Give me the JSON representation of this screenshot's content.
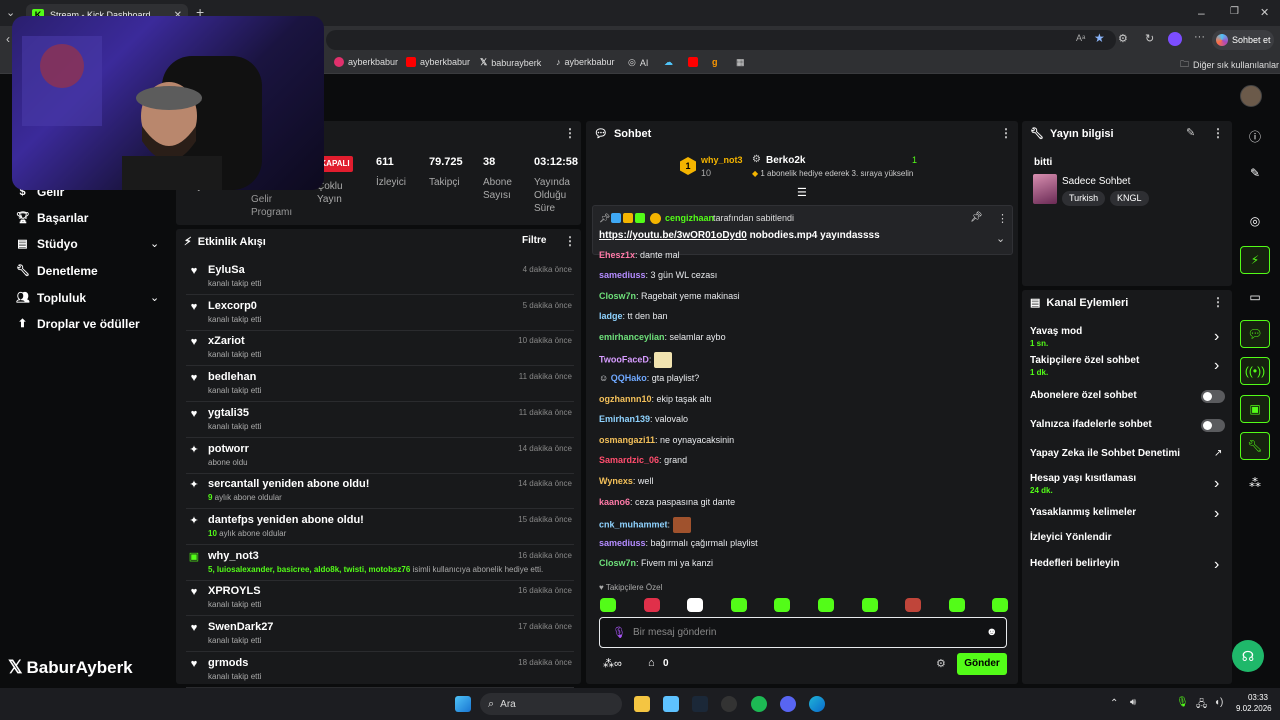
{
  "browser": {
    "tab_title": "Stream - Kick Dashboard",
    "copilot_label": "Sohbet et",
    "bookmarks": [
      {
        "label": "ayberkbabur",
        "color": "#e1306c"
      },
      {
        "label": "ayberkbabur",
        "color": "#ff0000"
      },
      {
        "label": "baburayberk",
        "color": "#ffffff"
      },
      {
        "label": "ayberkbabur",
        "color": "#ffffff"
      },
      {
        "label": "AI",
        "color": "#cccccc"
      }
    ],
    "other_bookmarks": "Diğer sık kullanılanlar"
  },
  "sidebar": {
    "items": [
      {
        "label": "Gelir",
        "icon": "dollar-icon"
      },
      {
        "label": "Başarılar",
        "icon": "trophy-icon"
      },
      {
        "label": "Stüdyo",
        "icon": "studio-icon",
        "has_chevron": true
      },
      {
        "label": "Denetleme",
        "icon": "wrench-icon"
      },
      {
        "label": "Topluluk",
        "icon": "people-icon",
        "has_chevron": true
      },
      {
        "label": "Droplar ve ödüller",
        "icon": "drops-icon"
      }
    ],
    "watermark": "BaburAyberk"
  },
  "stats": {
    "closed_badge": "KAPALI",
    "items": [
      {
        "value": "",
        "label": "Yayın"
      },
      {
        "value": "",
        "label": "Partnerlik Gelir Programı"
      },
      {
        "value": "",
        "label": "Çoklu Yayın"
      },
      {
        "value": "611",
        "label": "İzleyici"
      },
      {
        "value": "79.725",
        "label": "Takipçi"
      },
      {
        "value": "38",
        "label": "Abone Sayısı"
      },
      {
        "value": "03:12:58",
        "label": "Yayında Olduğu Süre"
      }
    ]
  },
  "activity": {
    "title": "Etkinlik Akışı",
    "filter": "Filtre",
    "rows": [
      {
        "icon": "heart-icon",
        "name": "EyluSa",
        "sub": "kanalı takip etti",
        "time": "4 dakika önce"
      },
      {
        "icon": "heart-icon",
        "name": "Lexcorp0",
        "sub": "kanalı takip etti",
        "time": "5 dakika önce"
      },
      {
        "icon": "heart-icon",
        "name": "xZariot",
        "sub": "kanalı takip etti",
        "time": "10 dakika önce"
      },
      {
        "icon": "heart-icon",
        "name": "bedlehan",
        "sub": "kanalı takip etti",
        "time": "11 dakika önce"
      },
      {
        "icon": "heart-icon",
        "name": "ygtali35",
        "sub": "kanalı takip etti",
        "time": "11 dakika önce"
      },
      {
        "icon": "sparkle-icon",
        "name": "potworr",
        "sub": "abone oldu",
        "time": "14 dakika önce"
      },
      {
        "icon": "sparkle-icon",
        "name": "sercantall yeniden abone oldu!",
        "sub_green": "9",
        "sub": " aylık abone oldular",
        "time": "14 dakika önce"
      },
      {
        "icon": "sparkle-icon",
        "name": "dantefps yeniden abone oldu!",
        "sub_green": "10",
        "sub": " aylık abone oldular",
        "time": "15 dakika önce"
      },
      {
        "icon": "gift-icon",
        "name": "why_not3",
        "sub_green": "5, luiosalexander, basicree, aldo8k, twisti, motobsz76",
        "sub": " isimli kullanıcıya abonelik hediye etti.",
        "time": "16 dakika önce"
      },
      {
        "icon": "heart-icon",
        "name": "XPROYLS",
        "sub": "kanalı takip etti",
        "time": "16 dakika önce"
      },
      {
        "icon": "heart-icon",
        "name": "SwenDark27",
        "sub": "kanalı takip etti",
        "time": "17 dakika önce"
      },
      {
        "icon": "heart-icon",
        "name": "grmods",
        "sub": "kanalı takip etti",
        "time": "18 dakika önce"
      }
    ]
  },
  "chat": {
    "title": "Sohbet",
    "gift_top": {
      "rank": "1",
      "user": "why_not3",
      "count": "10",
      "gifter": "Berko2k",
      "gifter_count": "1",
      "message": "1 abonelik hediye ederek 3. sıraya yükselin"
    },
    "pinned": {
      "by": "cengizhaan",
      "by_suffix": "tarafından sabitlendi",
      "link": "https://youtu.be/3wOR01oDyd0",
      "text": " nobodies.mp4 yayındassss"
    },
    "cut_line": {
      "user": "Ehesz1x",
      "text": "dante mal"
    },
    "messages": [
      {
        "user": "samediuss",
        "color": "#b48cff",
        "text": "3 gün WL cezası"
      },
      {
        "user": "Closw7n",
        "color": "#6ee07a",
        "text": "Ragebait yeme makinasi"
      },
      {
        "user": "ladge",
        "color": "#8fd3ff",
        "text": "tt den ban"
      },
      {
        "user": "emirhanceylian",
        "color": "#6ee07a",
        "text": "selamlar aybo"
      },
      {
        "user": "TwooFaceD",
        "color": "#d69cff",
        "text": "",
        "emote": true
      },
      {
        "user": "QQHako",
        "color": "#6fa8ff",
        "text": "gta playlist?"
      },
      {
        "user": "ogzhannn10",
        "color": "#f3c05a",
        "text": "ekip taşak altı"
      },
      {
        "user": "Emirhan139",
        "color": "#8fd3ff",
        "text": "valovalo"
      },
      {
        "user": "osmangazi11",
        "color": "#f3c05a",
        "text": "ne oynayacaksinin"
      },
      {
        "user": "Samardzic_06",
        "color": "#ff4d6d",
        "text": "grand"
      },
      {
        "user": "Wynexs",
        "color": "#f3c05a",
        "text": "well"
      },
      {
        "user": "kaano6",
        "color": "#ff7aa8",
        "text": "ceza paspasına git dante"
      },
      {
        "user": "cnk_muhammet",
        "color": "#8fd3ff",
        "text": "",
        "emote": true
      },
      {
        "user": "samediuss",
        "color": "#b48cff",
        "text": "bağırmalı çağırmalı playlist"
      },
      {
        "user": "Closw7n",
        "color": "#6ee07a",
        "text": "Fivem mi ya kanzi"
      }
    ],
    "followers_only": "Takipçilere Özel",
    "input_placeholder": "Bir mesaj gönderin",
    "points": "0",
    "send": "Gönder"
  },
  "stream_info": {
    "title": "Yayın bilgisi",
    "stream_title": "bitti",
    "category": "Sadece Sohbet",
    "tags": [
      "Turkish",
      "KNGL"
    ]
  },
  "channel_actions": {
    "title": "Kanal Eylemleri",
    "rows": [
      {
        "label": "Yavaş mod",
        "sub": "1 sn.",
        "control": "arrow"
      },
      {
        "label": "Takipçilere özel sohbet",
        "sub": "1 dk.",
        "control": "arrow"
      },
      {
        "label": "Abonelere özel sohbet",
        "sub": "",
        "control": "toggle"
      },
      {
        "label": "Yalnızca ifadelerle sohbet",
        "sub": "",
        "control": "toggle"
      },
      {
        "label": "Yapay Zeka ile Sohbet Denetimi",
        "sub": "",
        "control": "external"
      },
      {
        "label": "Hesap yaşı kısıtlaması",
        "sub": "24 dk.",
        "control": "arrow"
      },
      {
        "label": "Yasaklanmış kelimeler",
        "sub": "",
        "control": "arrow"
      },
      {
        "label": "İzleyici Yönlendir",
        "sub": "",
        "control": "none"
      },
      {
        "label": "Hedefleri belirleyin",
        "sub": "",
        "control": "arrow"
      }
    ]
  },
  "taskbar": {
    "search": "Ara",
    "time": "03:33",
    "date": "9.02.2026"
  },
  "colors": {
    "accent": "#53fc18",
    "panel": "#18191b",
    "bg": "#0b0c0d"
  }
}
